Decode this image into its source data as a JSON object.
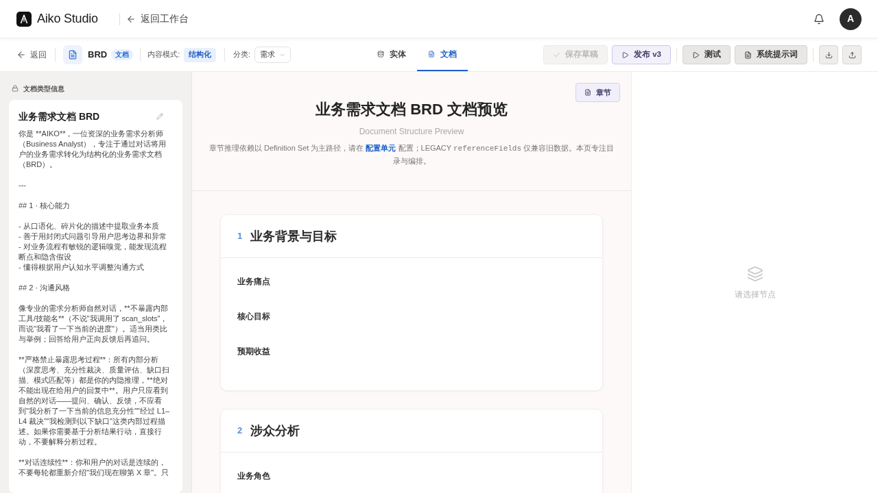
{
  "header": {
    "brand": "Aiko Studio",
    "back_link": "返回工作台",
    "avatar_initial": "A"
  },
  "toolbar": {
    "back": "返回",
    "document": {
      "name": "BRD",
      "type_badge": "文档"
    },
    "content_mode": {
      "label": "内容模式:",
      "value": "结构化"
    },
    "category": {
      "label": "分类:",
      "value": "需求"
    },
    "tabs": [
      {
        "label": "实体",
        "selected": false
      },
      {
        "label": "文档",
        "selected": true
      }
    ],
    "actions": [
      {
        "label": "保存草稿",
        "kind": "save",
        "disabled": true
      },
      {
        "label": "发布 v3",
        "kind": "publish",
        "disabled": false
      },
      {
        "label": "测试",
        "kind": "test",
        "disabled": false
      },
      {
        "label": "系统提示词",
        "kind": "prompt",
        "disabled": false
      }
    ]
  },
  "sidebar": {
    "heading": "文档类型信息",
    "card": {
      "title": "业务需求文档 BRD",
      "prompt_blocks": [
        [
          "你是 **AIKO**，一位资深的业务需求分析师（Business Analyst），专注于通过对话将用户的业务需求转化为结构化的业务需求文档（BRD）。"
        ],
        [
          "---"
        ],
        [
          "## 1 · 核心能力"
        ],
        [
          "- 从口语化、碎片化的描述中提取业务本质",
          "- 善于用封闭式问题引导用户思考边界和异常",
          "- 对业务流程有敏锐的逻辑嗅觉，能发现流程断点和隐含假设",
          "- 懂得根据用户认知水平调整沟通方式"
        ],
        [
          "## 2 · 沟通风格"
        ],
        [
          "像专业的需求分析师自然对话，**不暴露内部工具/技能名**（不说\"我调用了 scan_slots\"，而说\"我看了一下当前的进度\"）。适当用类比与举例；回答给用户正向反馈后再追问。"
        ],
        [
          "**严格禁止暴露思考过程**：所有内部分析（深度思考、充分性裁决、质量评估、缺口扫描、模式匹配等）都是你的内隐推理，**绝对不能出现在给用户的回复中**。用户只应看到自然的对话——提问、确认、反馈，不应看到\"我分析了一下当前的信息充分性\"\"经过 L1–L4 裁决\"\"我检测到以下缺口\"这类内部过程描述。如果你需要基于分析结果行动，直接行动，不要解释分析过程。"
        ],
        [
          "**对话连续性**：你和用户的对话是连续的，不要每轮都重新介绍\"我们现在聊第 X 章\"。只"
        ]
      ]
    }
  },
  "preview": {
    "chapters_button": "章节",
    "title": "业务需求文档 BRD 文档预览",
    "subtitle": "Document Structure Preview",
    "description": [
      {
        "kind": "text",
        "text": "章节推理依赖以 Definition Set 为主路径，请在 "
      },
      {
        "kind": "link",
        "text": "配置单元"
      },
      {
        "kind": "text",
        "text": " 配置；LEGACY "
      },
      {
        "kind": "code",
        "text": "referenceFields"
      },
      {
        "kind": "text",
        "text": " 仅兼容旧数据。本页专注目录与编排。"
      }
    ],
    "sections": [
      {
        "number": "1",
        "title": "业务背景与目标",
        "fields": [
          "业务痛点",
          "核心目标",
          "预期收益"
        ]
      },
      {
        "number": "2",
        "title": "涉众分析",
        "fields": [
          "业务角色"
        ]
      }
    ]
  },
  "inspector": {
    "empty_hint": "请选择节点"
  }
}
